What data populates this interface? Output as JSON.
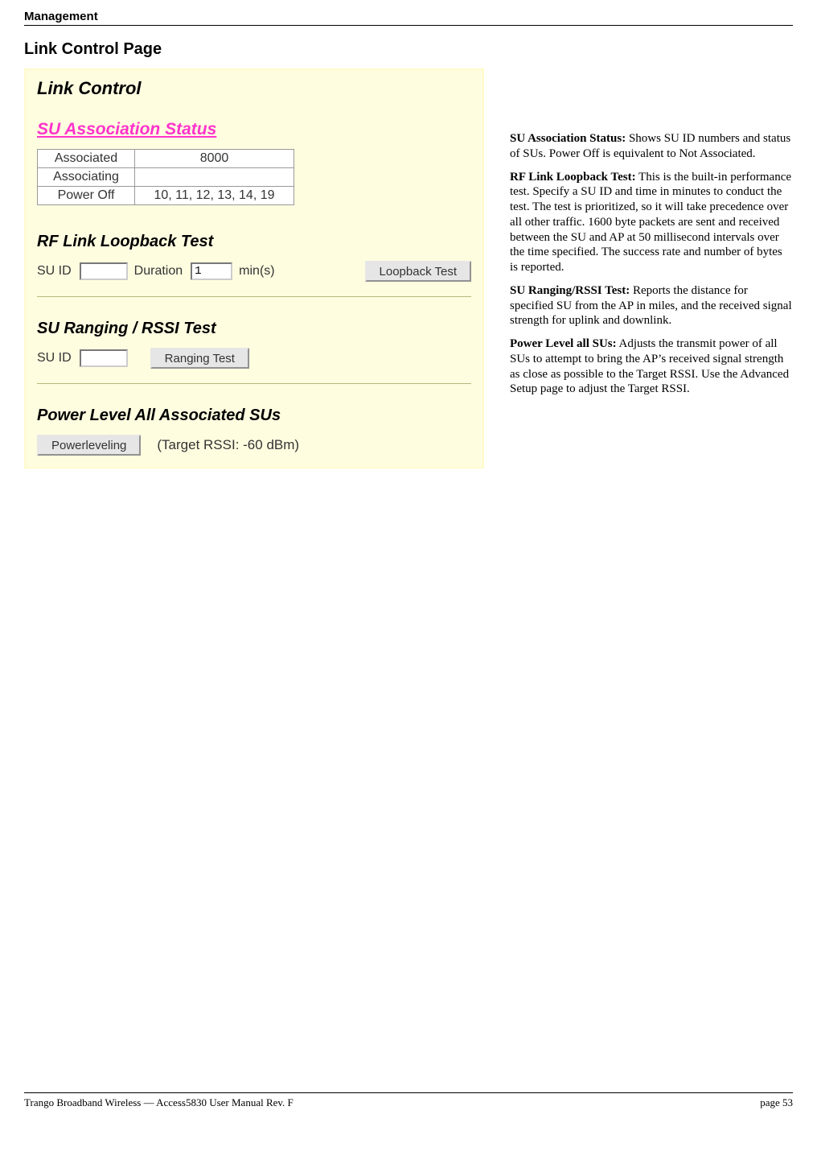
{
  "header": "Management",
  "section_title": "Link Control Page",
  "screenshot": {
    "title": "Link Control",
    "assoc_title": "SU Association Status",
    "assoc_table": {
      "rows": [
        {
          "label": "Associated",
          "value": "8000"
        },
        {
          "label": "Associating",
          "value": ""
        },
        {
          "label": "Power Off",
          "value": "10, 11, 12, 13, 14, 19"
        }
      ]
    },
    "loopback": {
      "title": "RF Link Loopback Test",
      "suid_label": "SU ID",
      "suid_value": "",
      "duration_label": "Duration",
      "duration_value": "1",
      "duration_unit": "min(s)",
      "button": "Loopback Test"
    },
    "ranging": {
      "title": "SU Ranging / RSSI Test",
      "suid_label": "SU ID",
      "suid_value": "",
      "button": "Ranging Test"
    },
    "powerlevel": {
      "title": "Power Level All Associated SUs",
      "button": "Powerleveling",
      "target_note": "(Target RSSI: -60 dBm)"
    }
  },
  "descriptions": {
    "assoc": {
      "label": "SU Association Status:",
      "text": "  Shows SU ID numbers and status of SUs.  Power Off is equivalent to Not Associated."
    },
    "loopback": {
      "label": "RF Link Loopback Test:",
      "text": "  This is the built-in performance test.  Specify a SU ID and time in minutes to conduct the test.  The test is prioritized, so it will take precedence over all other traffic.  1600 byte packets are sent and received between the SU and AP at 50 millisecond intervals over the time specified.  The success rate and number of bytes is reported."
    },
    "ranging": {
      "label": "SU Ranging/RSSI Test:",
      "text": "  Reports the distance for specified SU from the AP in miles, and the received signal strength for uplink and downlink."
    },
    "power": {
      "label": "Power Level all SUs:",
      "text": "  Adjusts the transmit power of all SUs to attempt to bring the AP’s received signal strength as close as possible to the Target RSSI.  Use the Advanced Setup page to adjust the Target RSSI."
    }
  },
  "footer": {
    "left": "Trango Broadband Wireless — Access5830 User Manual  Rev. F",
    "right": "page 53"
  }
}
